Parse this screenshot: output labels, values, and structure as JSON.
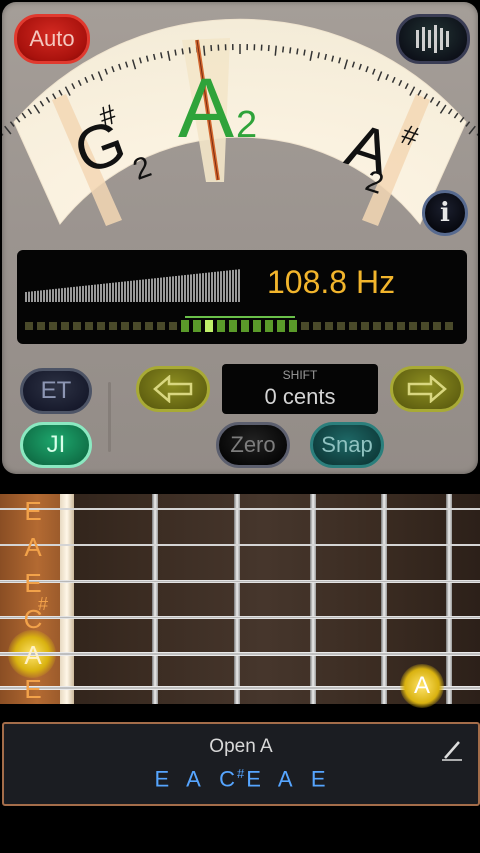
{
  "header": {
    "auto_label": "Auto",
    "bars_button": "bars-icon",
    "info_button": "info-icon"
  },
  "dial": {
    "left_note": {
      "letter": "G",
      "accidental": "#",
      "octave": "2"
    },
    "center_note": {
      "letter": "A",
      "octave": "2"
    },
    "right_note": {
      "letter": "A",
      "accidental": "#",
      "octave": "2"
    }
  },
  "readout": {
    "frequency": "108.8 Hz"
  },
  "controls": {
    "et_label": "ET",
    "ji_label": "JI",
    "left_arrow": "arrow-left-icon",
    "right_arrow": "arrow-right-icon",
    "shift_label": "SHIFT",
    "shift_value": "0 cents",
    "zero_label": "Zero",
    "snap_label": "Snap"
  },
  "fretboard": {
    "strings": [
      "E",
      "A",
      "E",
      "C",
      "A",
      "E"
    ],
    "string_accidentals": [
      "",
      "",
      "",
      "#",
      "",
      ""
    ],
    "marker_note": "A"
  },
  "tuning": {
    "name": "Open A",
    "notes": [
      "E",
      "A",
      "C",
      "E",
      "A",
      "E"
    ],
    "notes_accidentals": [
      "",
      "",
      "#",
      "",
      "",
      ""
    ],
    "edit_icon": "pencil-icon"
  },
  "colors": {
    "accent_orange": "#f2b52c",
    "tuning_blue": "#56a5ff",
    "center_note_green": "#2fa33a",
    "ji_green": "#1ea86e",
    "auto_red": "#d42a22"
  }
}
